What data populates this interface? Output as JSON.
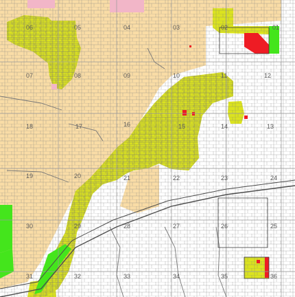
{
  "map": {
    "zone_colors": {
      "tan": "#f9dca6",
      "yellow": "#dbe31f",
      "green": "#44e51c",
      "red": "#ee1c24",
      "pink": "#f2b6c8",
      "white": "#ffffff"
    },
    "section_labels": [
      "06",
      "05",
      "04",
      "03",
      "02",
      "01",
      "07",
      "08",
      "09",
      "10",
      "11",
      "12",
      "18",
      "17",
      "16",
      "15",
      "14",
      "13",
      "19",
      "20",
      "21",
      "22",
      "23",
      "24",
      "30",
      "29",
      "28",
      "27",
      "26",
      "25",
      "31",
      "32",
      "33",
      "34",
      "35",
      "36"
    ]
  }
}
